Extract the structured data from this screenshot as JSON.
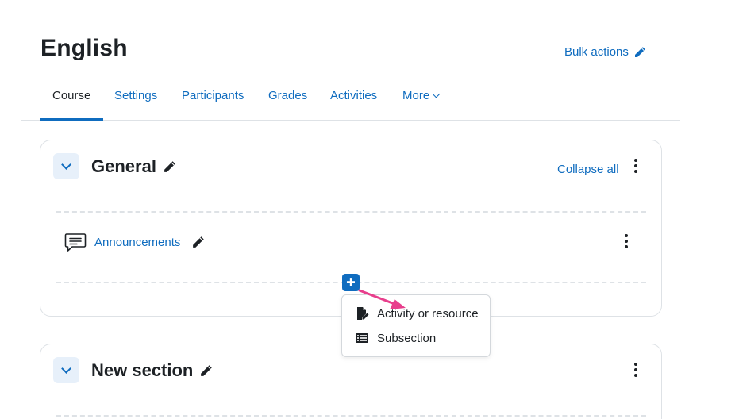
{
  "page": {
    "title": "English",
    "bulk_actions_label": "Bulk actions"
  },
  "tabs": [
    {
      "label": "Course",
      "active": true
    },
    {
      "label": "Settings"
    },
    {
      "label": "Participants"
    },
    {
      "label": "Grades"
    },
    {
      "label": "Activities"
    },
    {
      "label": "More"
    }
  ],
  "sections": {
    "general": {
      "title": "General",
      "collapse_all_label": "Collapse all",
      "activities": [
        {
          "name": "Announcements",
          "icon": "forum-icon"
        }
      ]
    },
    "new": {
      "title": "New section"
    }
  },
  "add_menu": {
    "items": [
      {
        "label": "Activity or resource",
        "icon": "file-edit-icon"
      },
      {
        "label": "Subsection",
        "icon": "list-icon"
      }
    ]
  },
  "colors": {
    "link": "#0f6cbf",
    "text": "#1d2125",
    "annotation_arrow": "#e83e8c",
    "toggle_bg": "#e7f0fa"
  }
}
